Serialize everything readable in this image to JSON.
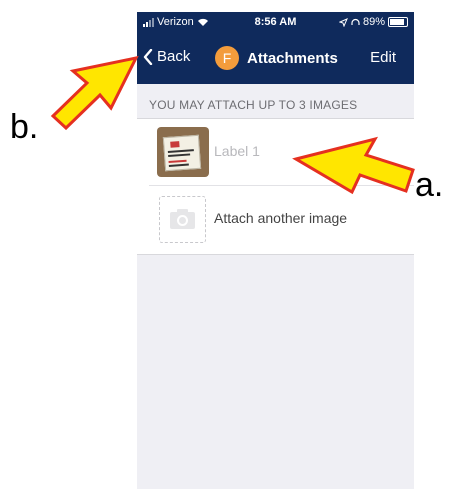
{
  "status_bar": {
    "carrier": "Verizon",
    "time": "8:56 AM",
    "battery": "89%"
  },
  "nav_bar": {
    "back_label": "Back",
    "avatar_letter": "F",
    "title": "Attachments",
    "edit_label": "Edit"
  },
  "section": {
    "header": "YOU MAY ATTACH UP TO 3 IMAGES"
  },
  "attachments": [
    {
      "label": "Label 1"
    }
  ],
  "attach_another_label": "Attach another image",
  "annotations": {
    "a": "a.",
    "b": "b."
  },
  "colors": {
    "nav_background": "#0f2a5c",
    "avatar": "#f39c3c",
    "callout_fill": "#ffe600",
    "callout_stroke": "#e53020"
  }
}
